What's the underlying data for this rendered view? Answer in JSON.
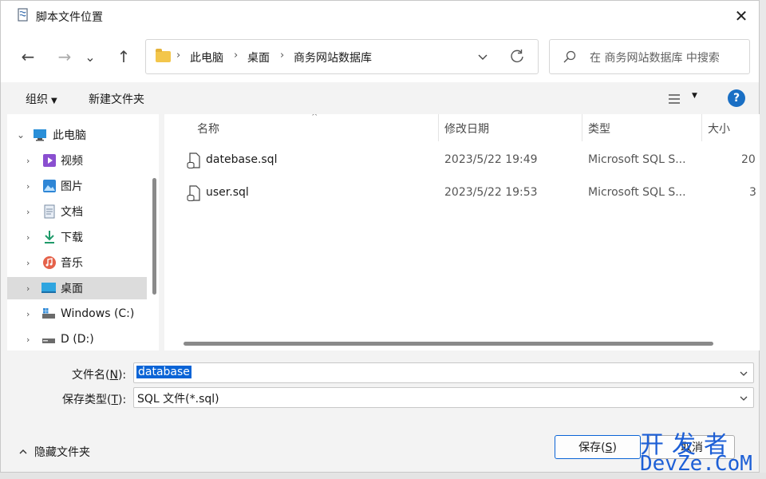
{
  "window": {
    "title": "脚本文件位置",
    "close_glyph": "✕"
  },
  "nav": {
    "back_glyph": "←",
    "forward_glyph": "→",
    "recent_glyph": "⌄",
    "up_glyph": "↑",
    "breadcrumb": [
      "此电脑",
      "桌面",
      "商务网站数据库"
    ],
    "search_placeholder": "在 商务网站数据库 中搜索"
  },
  "toolbar": {
    "organize_label": "组织",
    "new_folder_label": "新建文件夹",
    "help_glyph": "?"
  },
  "sidebar": {
    "items": [
      {
        "label": "此电脑",
        "icon": "pc-icon"
      },
      {
        "label": "视频",
        "icon": "video-icon"
      },
      {
        "label": "图片",
        "icon": "picture-icon"
      },
      {
        "label": "文档",
        "icon": "document-icon"
      },
      {
        "label": "下载",
        "icon": "download-icon"
      },
      {
        "label": "音乐",
        "icon": "music-icon"
      },
      {
        "label": "桌面",
        "icon": "desktop-icon"
      },
      {
        "label": "Windows (C:)",
        "icon": "drive-c-icon"
      },
      {
        "label": "D (D:)",
        "icon": "drive-d-icon"
      }
    ]
  },
  "files": {
    "columns": [
      "名称",
      "修改日期",
      "类型",
      "大小"
    ],
    "rows": [
      {
        "name": "datebase.sql",
        "modified": "2023/5/22 19:49",
        "type": "Microsoft SQL S...",
        "size": "20"
      },
      {
        "name": "user.sql",
        "modified": "2023/5/22 19:53",
        "type": "Microsoft SQL S...",
        "size": "3"
      }
    ]
  },
  "form": {
    "filename_label": "文件名(",
    "filename_key": "N",
    "filename_label_end": "):",
    "filename_value": "database",
    "filetype_label": "保存类型(",
    "filetype_key": "T",
    "filetype_label_end": "):",
    "filetype_value": "SQL 文件(*.sql)"
  },
  "footer": {
    "hide_folders_label": "隐藏文件夹",
    "save_label": "保存(",
    "save_key": "S",
    "save_label_end": ")",
    "cancel_label": "取消"
  },
  "watermark": {
    "line1": "开发者",
    "line2": "DevZe.CoM"
  },
  "colors": {
    "accent": "#0a64d6",
    "folder": "#f3c64b",
    "help": "#1a6fc4",
    "watermark": "#1d5fd6"
  }
}
